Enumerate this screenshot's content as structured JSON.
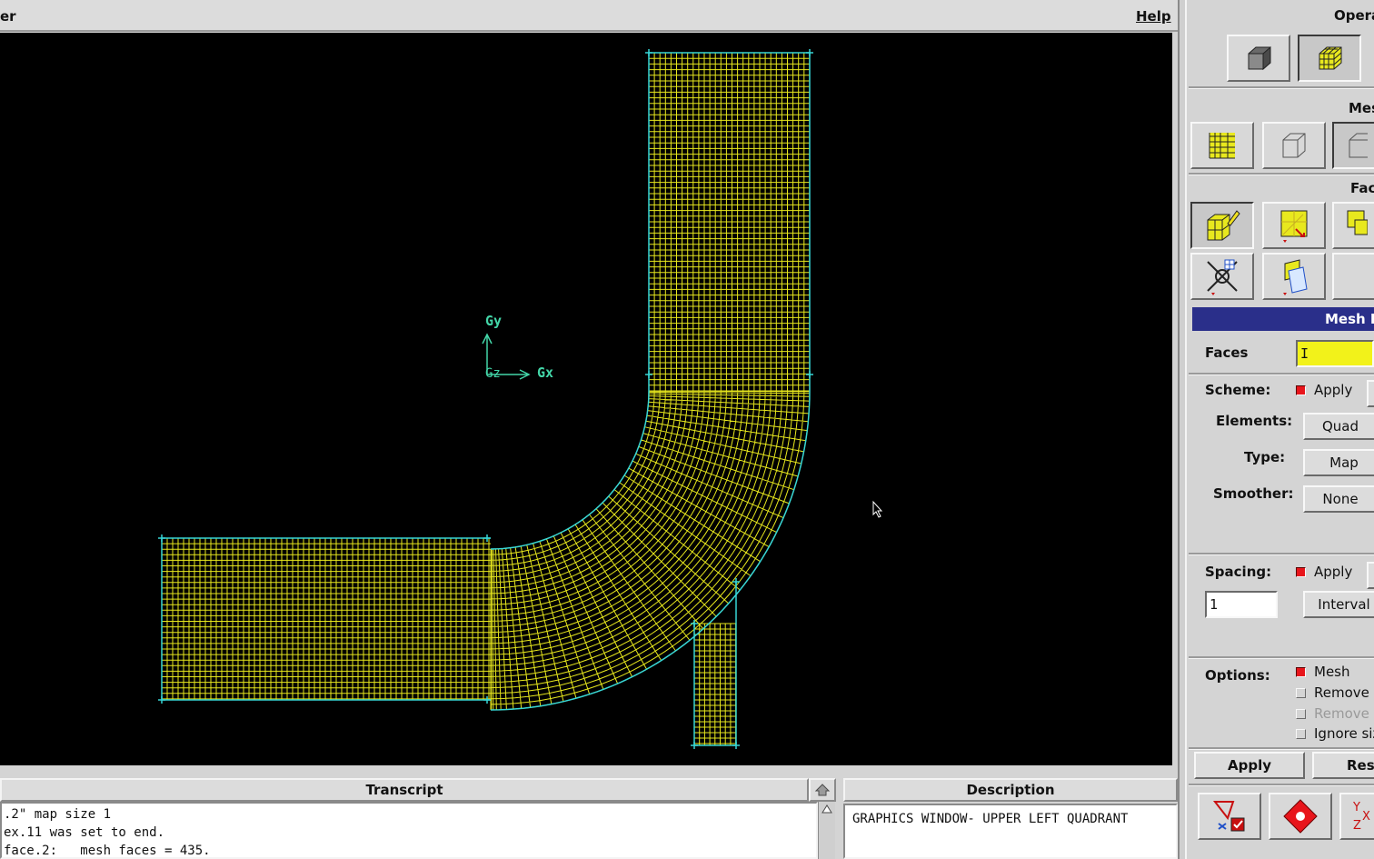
{
  "menubar": {
    "title_fragment": "er",
    "help": "Help"
  },
  "graphics": {
    "axis_labels": {
      "y": "Gy",
      "x": "Gx",
      "z": "Gz"
    },
    "colors": {
      "mesh": "#e8e81e",
      "edge": "#37d6d6",
      "axis": "#43d6a8",
      "background": "#000000"
    }
  },
  "transcript": {
    "title": "Transcript",
    "lines": [
      ".2\" map size 1",
      "ex.11 was set to end.",
      "face.2:   mesh faces = 435."
    ]
  },
  "description": {
    "title": "Description",
    "text": "GRAPHICS WINDOW- UPPER LEFT QUADRANT"
  },
  "operation": {
    "title": "Opera",
    "mesh_title": "Mes",
    "face_title": "Fac",
    "icons": [
      "solid-cube-icon",
      "mesh-cube-icon",
      "mesh-grid-icon",
      "wire-cube-icon",
      "wire-face-icon",
      "face-mesh-icon",
      "face-select-icon",
      "face-link-icon",
      "face-node-icon",
      "face-shape-icon"
    ]
  },
  "mesh_faces": {
    "title": "Mesh F",
    "faces_label": "Faces",
    "faces_value": "I",
    "scheme_label": "Scheme:",
    "scheme_apply": "Apply",
    "elements_label": "Elements:",
    "elements_value": "Quad",
    "type_label": "Type:",
    "type_value": "Map",
    "smoother_label": "Smoother:",
    "smoother_value": "None",
    "spacing_label": "Spacing:",
    "spacing_apply": "Apply",
    "spacing_value": "1",
    "spacing_type": "Interval",
    "options_label": "Options:",
    "options": [
      {
        "label": "Mesh",
        "checked": true,
        "disabled": false
      },
      {
        "label": "Remove o",
        "checked": false,
        "disabled": false
      },
      {
        "label": "Remove l",
        "checked": false,
        "disabled": true
      },
      {
        "label": "Ignore siz",
        "checked": false,
        "disabled": false
      }
    ],
    "apply_button": "Apply",
    "reset_button": "Res"
  }
}
